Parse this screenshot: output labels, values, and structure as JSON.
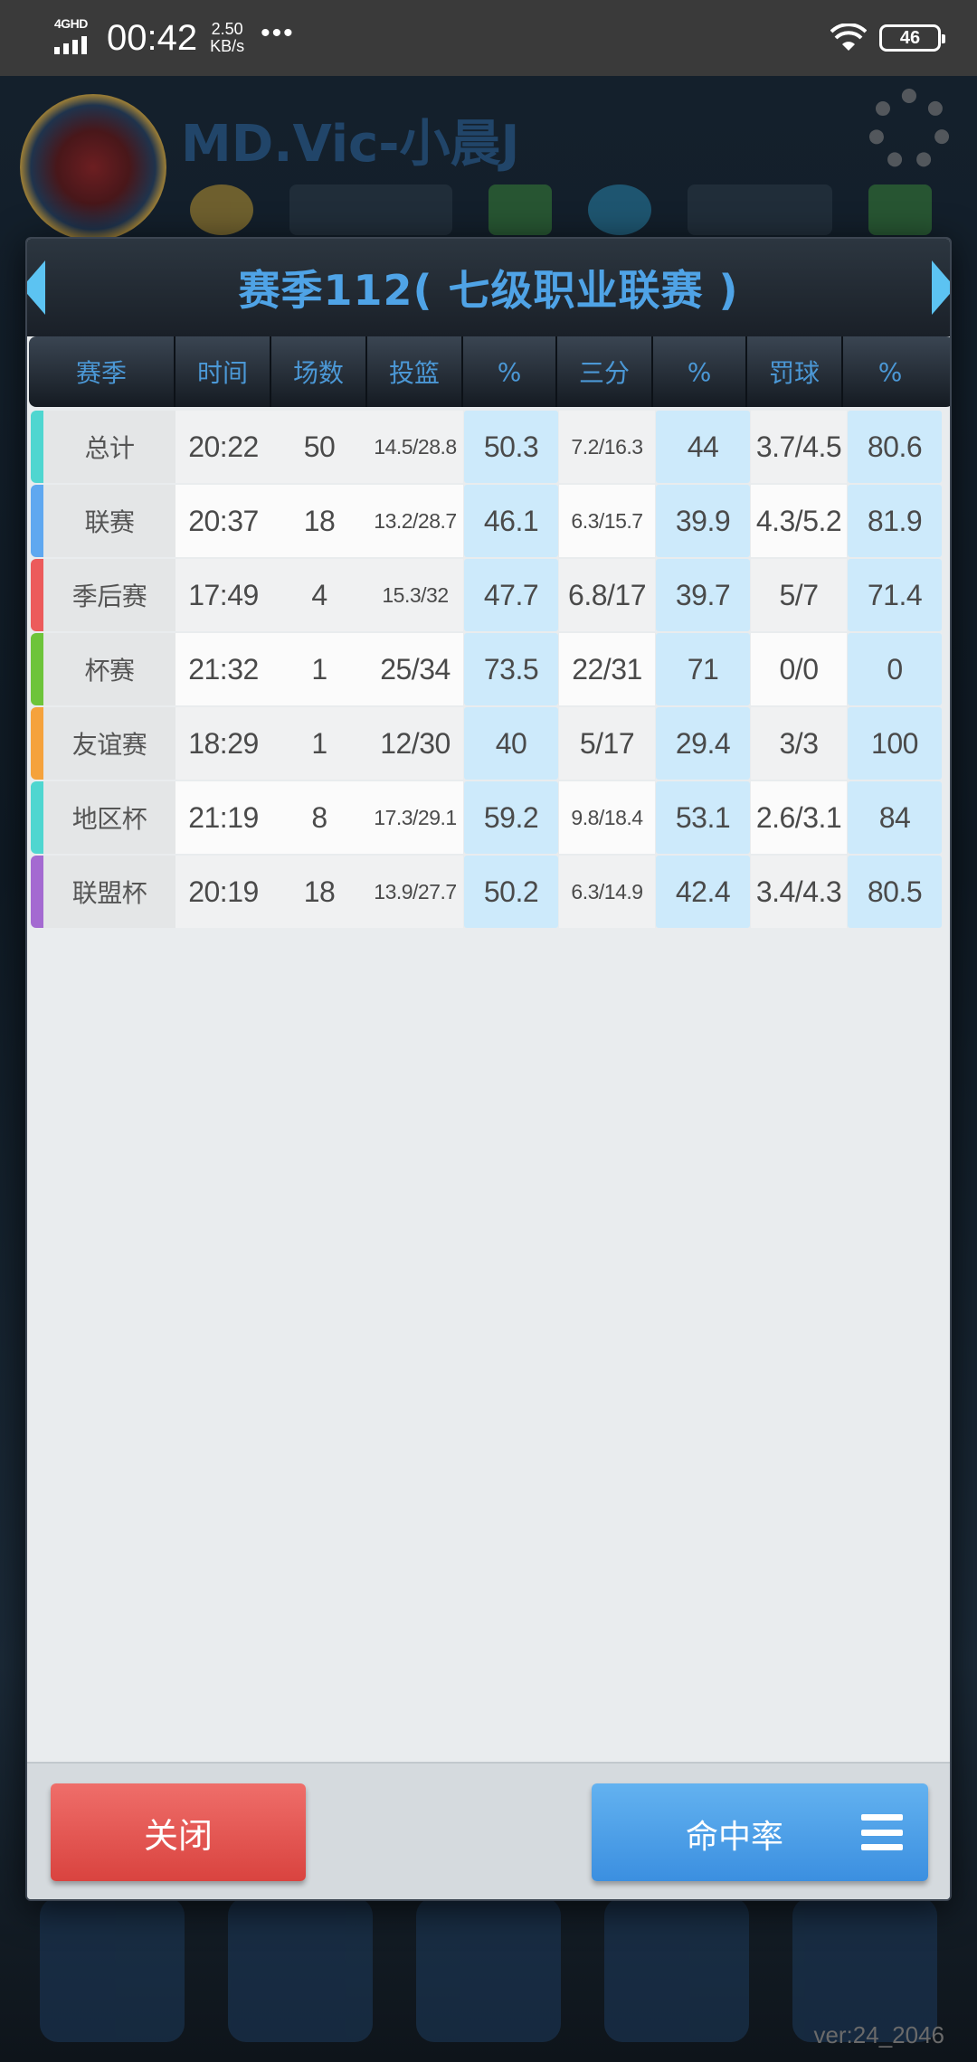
{
  "status_bar": {
    "network": "4GHD",
    "time": "00:42",
    "speed_value": "2.50",
    "speed_unit": "KB/s",
    "more": "•••",
    "battery": "46"
  },
  "background": {
    "player_name": "MD.Vic-小晨J",
    "version": "ver:24_2046"
  },
  "modal": {
    "title": "赛季112( 七级职业联赛 )",
    "headers": [
      "赛季",
      "时间",
      "场数",
      "投篮",
      "%",
      "三分",
      "%",
      "罚球",
      "%"
    ],
    "rows": [
      {
        "name": "总计",
        "time": "20:22",
        "games": "50",
        "fg": "14.5/28.8",
        "fg_pct": "50.3",
        "three": "7.2/16.3",
        "three_pct": "44",
        "ft": "3.7/4.5",
        "ft_pct": "80.6",
        "color": "#4fd6d0"
      },
      {
        "name": "联赛",
        "time": "20:37",
        "games": "18",
        "fg": "13.2/28.7",
        "fg_pct": "46.1",
        "three": "6.3/15.7",
        "three_pct": "39.9",
        "ft": "4.3/5.2",
        "ft_pct": "81.9",
        "color": "#5fa8f0"
      },
      {
        "name": "季后赛",
        "time": "17:49",
        "games": "4",
        "fg": "15.3/32",
        "fg_pct": "47.7",
        "three": "6.8/17",
        "three_pct": "39.7",
        "ft": "5/7",
        "ft_pct": "71.4",
        "color": "#ec5b5b"
      },
      {
        "name": "杯赛",
        "time": "21:32",
        "games": "1",
        "fg": "25/34",
        "fg_pct": "73.5",
        "three": "22/31",
        "three_pct": "71",
        "ft": "0/0",
        "ft_pct": "0",
        "color": "#6dc43a"
      },
      {
        "name": "友谊赛",
        "time": "18:29",
        "games": "1",
        "fg": "12/30",
        "fg_pct": "40",
        "three": "5/17",
        "three_pct": "29.4",
        "ft": "3/3",
        "ft_pct": "100",
        "color": "#f5a23c"
      },
      {
        "name": "地区杯",
        "time": "21:19",
        "games": "8",
        "fg": "17.3/29.1",
        "fg_pct": "59.2",
        "three": "9.8/18.4",
        "three_pct": "53.1",
        "ft": "2.6/3.1",
        "ft_pct": "84",
        "color": "#4fd6d0"
      },
      {
        "name": "联盟杯",
        "time": "20:19",
        "games": "18",
        "fg": "13.9/27.7",
        "fg_pct": "50.2",
        "three": "6.3/14.9",
        "three_pct": "42.4",
        "ft": "3.4/4.3",
        "ft_pct": "80.5",
        "color": "#a46ad1"
      }
    ]
  },
  "buttons": {
    "close": "关闭",
    "accuracy": "命中率"
  },
  "colors": {
    "title": "#4fa3e6",
    "header_text": "#4b98d6",
    "pct_cell": "#cdeafb",
    "close_button": "#e0524e",
    "accuracy_button": "#4a9ee6"
  }
}
